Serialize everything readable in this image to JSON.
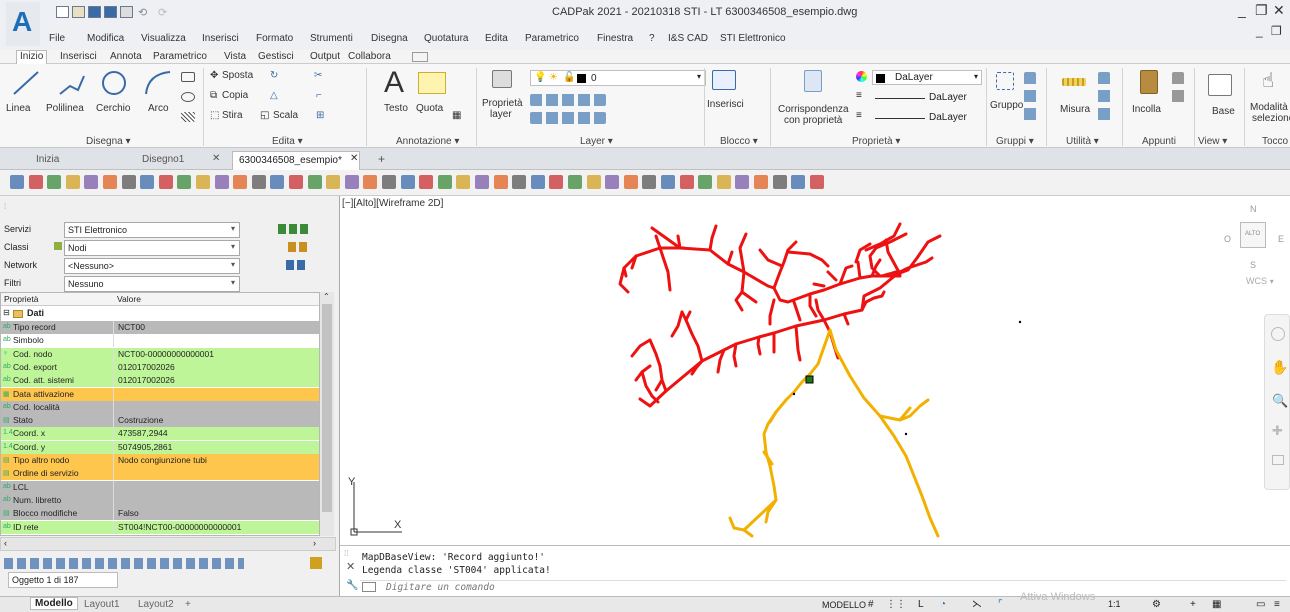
{
  "titlebar": {
    "title": "CADPak 2021 - 20210318 STI - LT   6300346508_esempio.dwg",
    "app_logo": "A",
    "window_controls": [
      "_",
      "❐",
      "✕"
    ]
  },
  "menubar": {
    "items": [
      "File",
      "Modifica",
      "Visualizza",
      "Inserisci",
      "Formato",
      "Strumenti",
      "Disegna",
      "Quotatura",
      "Edita",
      "Parametrico",
      "Finestra",
      "?",
      "I&S CAD",
      "STI Elettronico"
    ]
  },
  "ribbon_tabs": {
    "items": [
      "Inizio",
      "Inserisci",
      "Annota",
      "Parametrico",
      "Vista",
      "Gestisci",
      "Output",
      "Collabora"
    ]
  },
  "ribbon": {
    "draw": {
      "linea": "Linea",
      "polilinea": "Polilinea",
      "cerchio": "Cerchio",
      "arco": "Arco",
      "title": "Disegna ▾"
    },
    "edit": {
      "sposta": "Sposta",
      "copia": "Copia",
      "stira": "Stira",
      "scala": "Scala",
      "title": "Edita ▾"
    },
    "annot": {
      "testo": "Testo",
      "quota": "Quota",
      "title": "Annotazione ▾"
    },
    "layer": {
      "proprieta": "Proprietà",
      "layer": "layer",
      "current": "0",
      "title": "Layer ▾"
    },
    "block": {
      "inserisci": "Inserisci",
      "title": "Blocco ▾"
    },
    "props": {
      "corrispondenza": "Corrispondenza",
      "con_proprieta": "con proprietà",
      "dalayer1": "DaLayer",
      "dalayer2": "DaLayer",
      "dalayer3": "DaLayer",
      "title": "Proprietà ▾"
    },
    "groups": {
      "gruppo": "Gruppo",
      "title": "Gruppi ▾"
    },
    "util": {
      "misura": "Misura",
      "title": "Utilità ▾"
    },
    "clip": {
      "incolla": "Incolla",
      "title": "Appunti"
    },
    "view": {
      "base": "Base",
      "title": "View ▾"
    },
    "touch": {
      "modalita": "Modalità",
      "selezione": "selezione",
      "title": "Tocco"
    }
  },
  "doc_tabs": {
    "items": [
      "Inizia",
      "Disegno1",
      "6300346508_esempio*"
    ],
    "add": "+"
  },
  "left_panel": {
    "servizi_label": "Servizi",
    "servizi_value": "STI Elettronico",
    "classi_label": "Classi",
    "classi_value": "Nodi",
    "network_label": "Network",
    "network_value": "<Nessuno>",
    "filtri_label": "Filtri",
    "filtri_value": "Nessuno",
    "col_prop": "Proprietà",
    "col_val": "Valore",
    "group": "Dati",
    "rows": [
      {
        "icon": "ab",
        "key": "Tipo record",
        "val": "NCT00",
        "bg": "gray"
      },
      {
        "icon": "ab",
        "key": "Simbolo",
        "val": "",
        "bg": "white"
      },
      {
        "icon": "♀",
        "key": "Cod. nodo",
        "val": "NCT00-00000000000001",
        "bg": "green"
      },
      {
        "icon": "ab",
        "key": "Cod. export",
        "val": "012017002026",
        "bg": "green"
      },
      {
        "icon": "ab",
        "key": "Cod. att. sistemi",
        "val": "012017002026",
        "bg": "green"
      },
      {
        "icon": "▦",
        "key": "Data attivazione",
        "val": "",
        "bg": "orange"
      },
      {
        "icon": "ab",
        "key": "Cod. località",
        "val": "",
        "bg": "gray"
      },
      {
        "icon": "▤",
        "key": "Stato",
        "val": "Costruzione",
        "bg": "gray"
      },
      {
        "icon": "1.4",
        "key": "Coord. x",
        "val": "473587,2944",
        "bg": "green"
      },
      {
        "icon": "1.4",
        "key": "Coord. y",
        "val": "5074905,2861",
        "bg": "green"
      },
      {
        "icon": "▤",
        "key": "Tipo altro nodo",
        "val": "Nodo congiunzione tubi",
        "bg": "orange"
      },
      {
        "icon": "▤",
        "key": "Ordine di servizio",
        "val": "",
        "bg": "orange"
      },
      {
        "icon": "ab",
        "key": "LCL",
        "val": "",
        "bg": "gray"
      },
      {
        "icon": "ab",
        "key": "Num. libretto",
        "val": "",
        "bg": "gray"
      },
      {
        "icon": "▤",
        "key": "Blocco modifiche",
        "val": "Falso",
        "bg": "gray"
      },
      {
        "icon": "ab",
        "key": "ID rete",
        "val": "ST004!NCT00-00000000000001",
        "bg": "green"
      }
    ],
    "object_count": "Oggetto 1 di 187"
  },
  "viewport": {
    "label": "[−][Alto][Wireframe 2D]",
    "compass": {
      "n": "N",
      "s": "S",
      "e": "E",
      "w": "O",
      "center": "ALTO"
    },
    "wcs": "WCS",
    "axis_y": "Y",
    "axis_x": "X"
  },
  "command": {
    "line1": "MapDBaseView: 'Record aggiunto!'",
    "line2": "Legenda classe 'ST004' applicata!",
    "placeholder": "Digitare un comando"
  },
  "statusbar": {
    "tabs": [
      "Modello",
      "Layout1",
      "Layout2"
    ],
    "add": "+",
    "modello": "MODELLO",
    "watermark": "Attiva Windows",
    "scale": "1:1"
  },
  "colors": {
    "red_network": "#ee1111",
    "orange_network": "#f2b000",
    "green_row": "#bff599",
    "orange_row": "#ffc64d",
    "gray_row": "#b9b9b9"
  }
}
